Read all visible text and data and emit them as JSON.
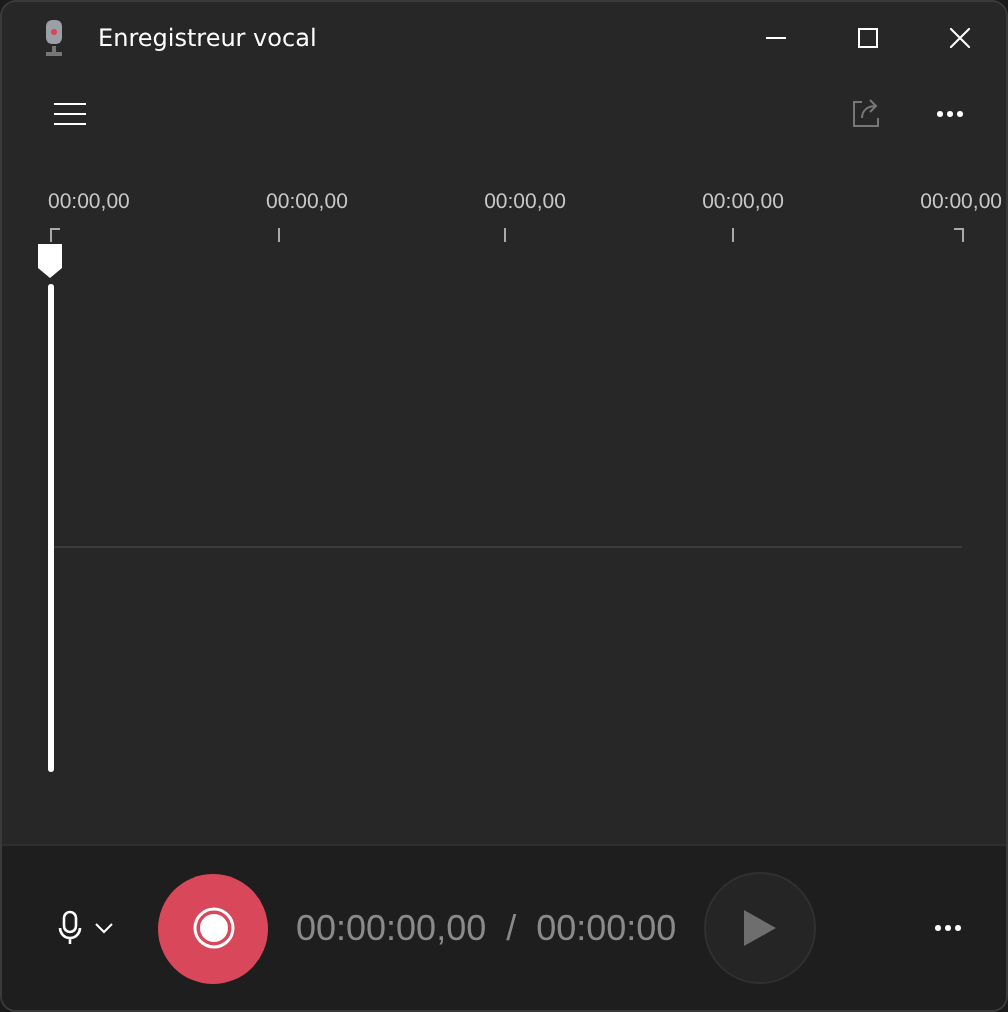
{
  "window": {
    "title": "Enregistreur vocal"
  },
  "timeline": {
    "labels": [
      "00:00,00",
      "00:00,00",
      "00:00,00",
      "00:00,00",
      "00:00,00"
    ]
  },
  "controls": {
    "elapsed": "00:00:00,00",
    "separator": "/",
    "total": "00:00:00",
    "play_disabled": true
  }
}
